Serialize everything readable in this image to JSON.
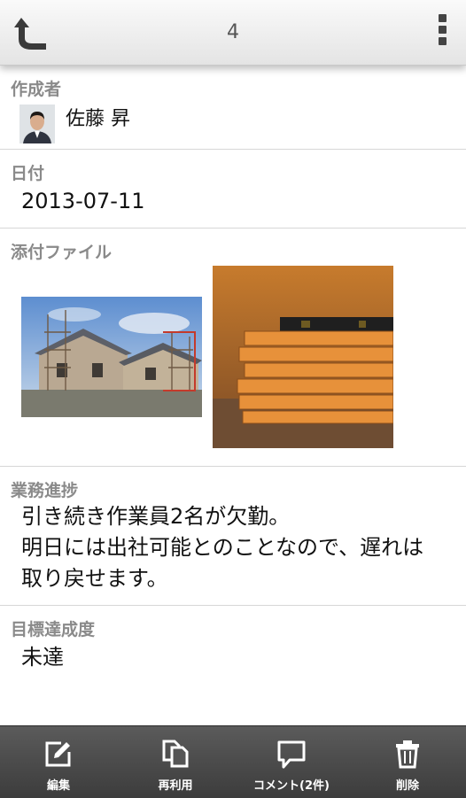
{
  "header": {
    "title": "4"
  },
  "author": {
    "label": "作成者",
    "name": "佐藤 昇"
  },
  "date": {
    "label": "日付",
    "value": "2013-07-11"
  },
  "attachments": {
    "label": "添付ファイル",
    "files": [
      {
        "subject": "house-under-construction"
      },
      {
        "subject": "lumber-and-level"
      }
    ]
  },
  "progress": {
    "label": "業務進捗",
    "lines": [
      "引き続き作業員2名が欠勤。",
      "明日には出社可能とのことなので、遅れは",
      "取り戻せます。"
    ]
  },
  "achievement": {
    "label": "目標達成度",
    "value": "未達"
  },
  "toolbar": {
    "edit": "編集",
    "reuse": "再利用",
    "comment": "コメント(2件)",
    "delete": "削除"
  },
  "colors": {
    "header_bg": "#ececec",
    "toolbar_bg": "#4a4a4a",
    "label": "#8a8a8a"
  }
}
